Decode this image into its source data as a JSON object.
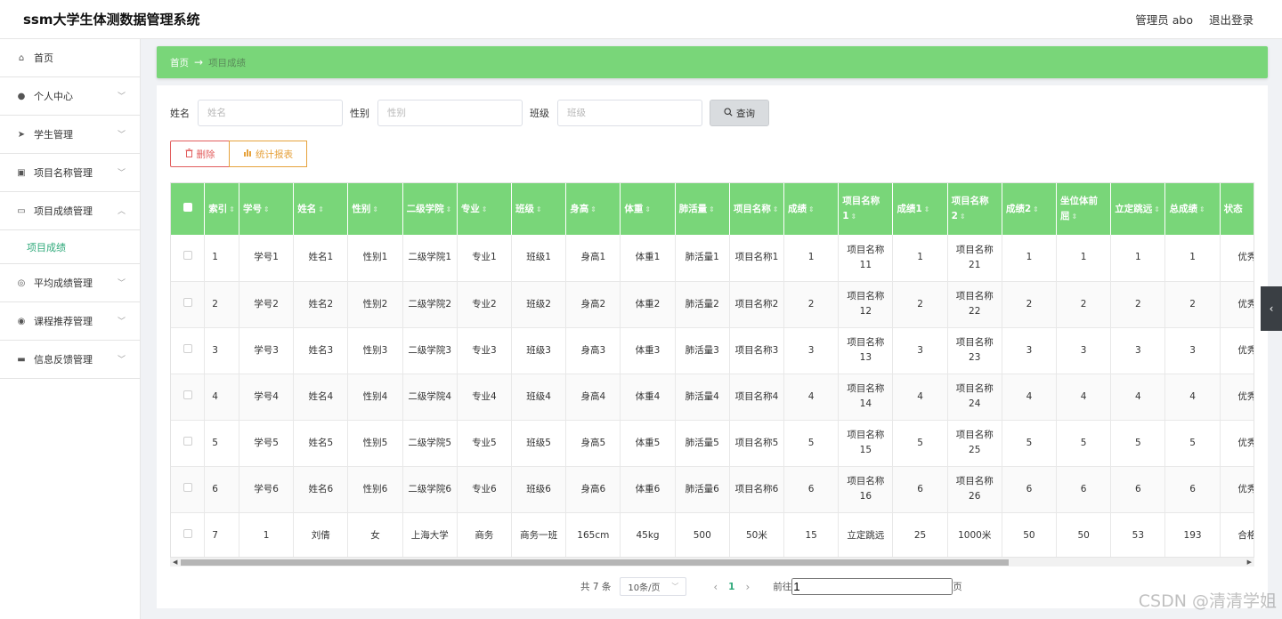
{
  "header": {
    "title": "ssm大学生体测数据管理系统",
    "user": "管理员 abo",
    "logout": "退出登录"
  },
  "sidebar": {
    "items": [
      {
        "label": "首页",
        "icon": "home-icon",
        "glyph": "⌂",
        "arrow": ""
      },
      {
        "label": "个人中心",
        "icon": "user-icon",
        "glyph": "●",
        "arrow": "﹀"
      },
      {
        "label": "学生管理",
        "icon": "paper-plane-icon",
        "glyph": "➤",
        "arrow": "﹀"
      },
      {
        "label": "项目名称管理",
        "icon": "clipboard-icon",
        "glyph": "▣",
        "arrow": "﹀"
      },
      {
        "label": "项目成绩管理",
        "icon": "card-icon",
        "glyph": "▭",
        "arrow": "︿"
      },
      {
        "label": "平均成绩管理",
        "icon": "crosshair-icon",
        "glyph": "◎",
        "arrow": "﹀"
      },
      {
        "label": "课程推荐管理",
        "icon": "badge-icon",
        "glyph": "◉",
        "arrow": "﹀"
      },
      {
        "label": "信息反馈管理",
        "icon": "box-icon",
        "glyph": "▬",
        "arrow": "﹀"
      }
    ],
    "submenu": "项目成绩"
  },
  "breadcrumb": {
    "home": "首页",
    "sep": "→",
    "current": "项目成绩"
  },
  "search": {
    "name_label": "姓名",
    "name_placeholder": "姓名",
    "gender_label": "性别",
    "gender_placeholder": "性别",
    "class_label": "班级",
    "class_placeholder": "班级",
    "query_label": "查询"
  },
  "actions": {
    "delete_label": "删除",
    "report_label": "统计报表"
  },
  "table": {
    "columns": [
      "索引",
      "学号",
      "姓名",
      "性别",
      "二级学院",
      "专业",
      "班级",
      "身高",
      "体重",
      "肺活量",
      "项目名称",
      "成绩",
      "项目名称1",
      "成绩1",
      "项目名称2",
      "成绩2",
      "坐位体前屈",
      "立定跳远",
      "总成绩",
      "状态"
    ],
    "rows": [
      [
        "1",
        "学号1",
        "姓名1",
        "性别1",
        "二级学院1",
        "专业1",
        "班级1",
        "身高1",
        "体重1",
        "肺活量1",
        "项目名称1",
        "1",
        "项目名称11",
        "1",
        "项目名称21",
        "1",
        "1",
        "1",
        "1",
        "优秀"
      ],
      [
        "2",
        "学号2",
        "姓名2",
        "性别2",
        "二级学院2",
        "专业2",
        "班级2",
        "身高2",
        "体重2",
        "肺活量2",
        "项目名称2",
        "2",
        "项目名称12",
        "2",
        "项目名称22",
        "2",
        "2",
        "2",
        "2",
        "优秀"
      ],
      [
        "3",
        "学号3",
        "姓名3",
        "性别3",
        "二级学院3",
        "专业3",
        "班级3",
        "身高3",
        "体重3",
        "肺活量3",
        "项目名称3",
        "3",
        "项目名称13",
        "3",
        "项目名称23",
        "3",
        "3",
        "3",
        "3",
        "优秀"
      ],
      [
        "4",
        "学号4",
        "姓名4",
        "性别4",
        "二级学院4",
        "专业4",
        "班级4",
        "身高4",
        "体重4",
        "肺活量4",
        "项目名称4",
        "4",
        "项目名称14",
        "4",
        "项目名称24",
        "4",
        "4",
        "4",
        "4",
        "优秀"
      ],
      [
        "5",
        "学号5",
        "姓名5",
        "性别5",
        "二级学院5",
        "专业5",
        "班级5",
        "身高5",
        "体重5",
        "肺活量5",
        "项目名称5",
        "5",
        "项目名称15",
        "5",
        "项目名称25",
        "5",
        "5",
        "5",
        "5",
        "优秀"
      ],
      [
        "6",
        "学号6",
        "姓名6",
        "性别6",
        "二级学院6",
        "专业6",
        "班级6",
        "身高6",
        "体重6",
        "肺活量6",
        "项目名称6",
        "6",
        "项目名称16",
        "6",
        "项目名称26",
        "6",
        "6",
        "6",
        "6",
        "优秀"
      ],
      [
        "7",
        "1",
        "刘倩",
        "女",
        "上海大学",
        "商务",
        "商务一班",
        "165cm",
        "45kg",
        "500",
        "50米",
        "15",
        "立定跳远",
        "25",
        "1000米",
        "50",
        "50",
        "53",
        "193",
        "合格"
      ]
    ]
  },
  "pager": {
    "total": "共 7 条",
    "page_size": "10条/页",
    "current_page": "1",
    "goto_label": "前往",
    "goto_value": "1",
    "page_unit": "页"
  },
  "watermark": "CSDN @清清学姐",
  "colors": {
    "accent": "#79d679",
    "active_text": "#2fa97a"
  }
}
